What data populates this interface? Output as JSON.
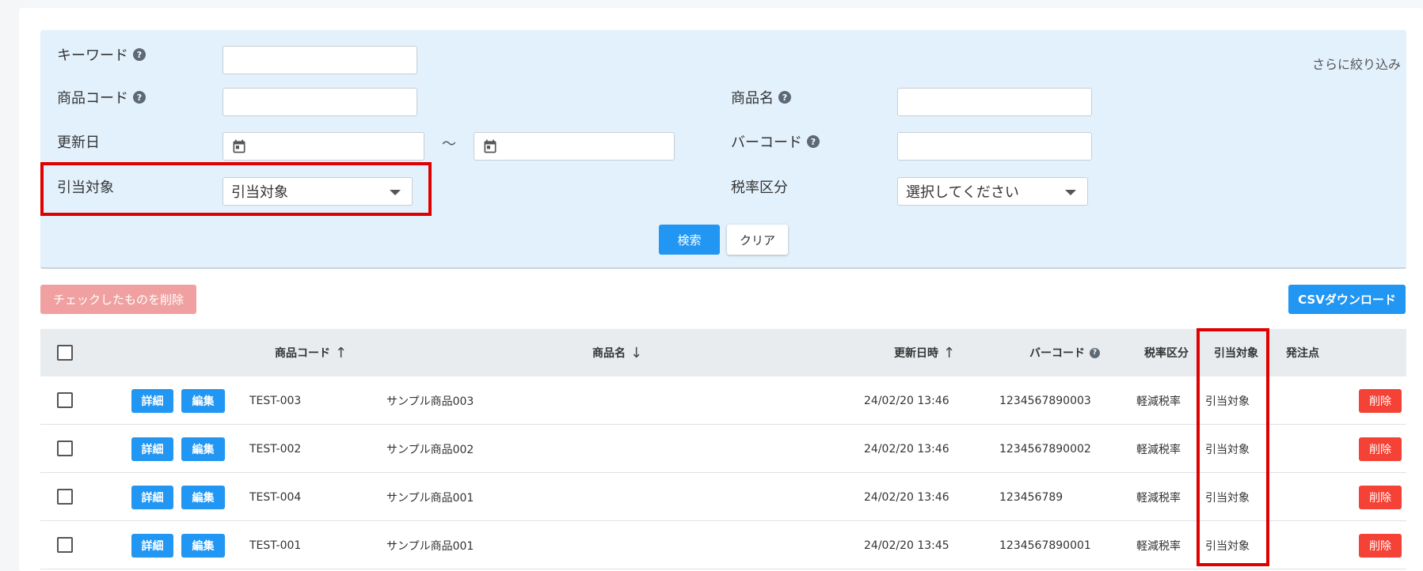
{
  "search": {
    "keyword_label": "キーワード",
    "code_label": "商品コード",
    "updated_label": "更新日",
    "tilde": "〜",
    "allocation_label": "引当対象",
    "allocation_value": "引当対象",
    "name_label": "商品名",
    "barcode_label": "バーコード",
    "tax_label": "税率区分",
    "tax_value": "選択してください",
    "more_link": "さらに絞り込み",
    "search_button": "検索",
    "clear_button": "クリア",
    "help_glyph": "?"
  },
  "toolbar": {
    "delete_checked": "チェックしたものを削除",
    "csv_download": "CSVダウンロード"
  },
  "table": {
    "headers": {
      "code": "商品コード",
      "name": "商品名",
      "updated": "更新日時",
      "barcode": "バーコード",
      "tax": "税率区分",
      "allocation": "引当対象",
      "order_point": "発注点"
    },
    "sort_up": "↑",
    "sort_down": "↓",
    "detail_label": "詳細",
    "edit_label": "編集",
    "delete_label": "削除",
    "rows": [
      {
        "code": "TEST-003",
        "name": "サンプル商品003",
        "updated": "24/02/20 13:46",
        "barcode": "1234567890003",
        "tax": "軽減税率",
        "allocation": "引当対象"
      },
      {
        "code": "TEST-002",
        "name": "サンプル商品002",
        "updated": "24/02/20 13:46",
        "barcode": "1234567890002",
        "tax": "軽減税率",
        "allocation": "引当対象"
      },
      {
        "code": "TEST-004",
        "name": "サンプル商品001",
        "updated": "24/02/20 13:46",
        "barcode": "123456789",
        "tax": "軽減税率",
        "allocation": "引当対象"
      },
      {
        "code": "TEST-001",
        "name": "サンプル商品001",
        "updated": "24/02/20 13:45",
        "barcode": "1234567890001",
        "tax": "軽減税率",
        "allocation": "引当対象"
      }
    ]
  },
  "colors": {
    "accent": "#2196f3",
    "danger": "#f44336",
    "highlight": "#e00000",
    "panel": "#e3f1fc"
  }
}
